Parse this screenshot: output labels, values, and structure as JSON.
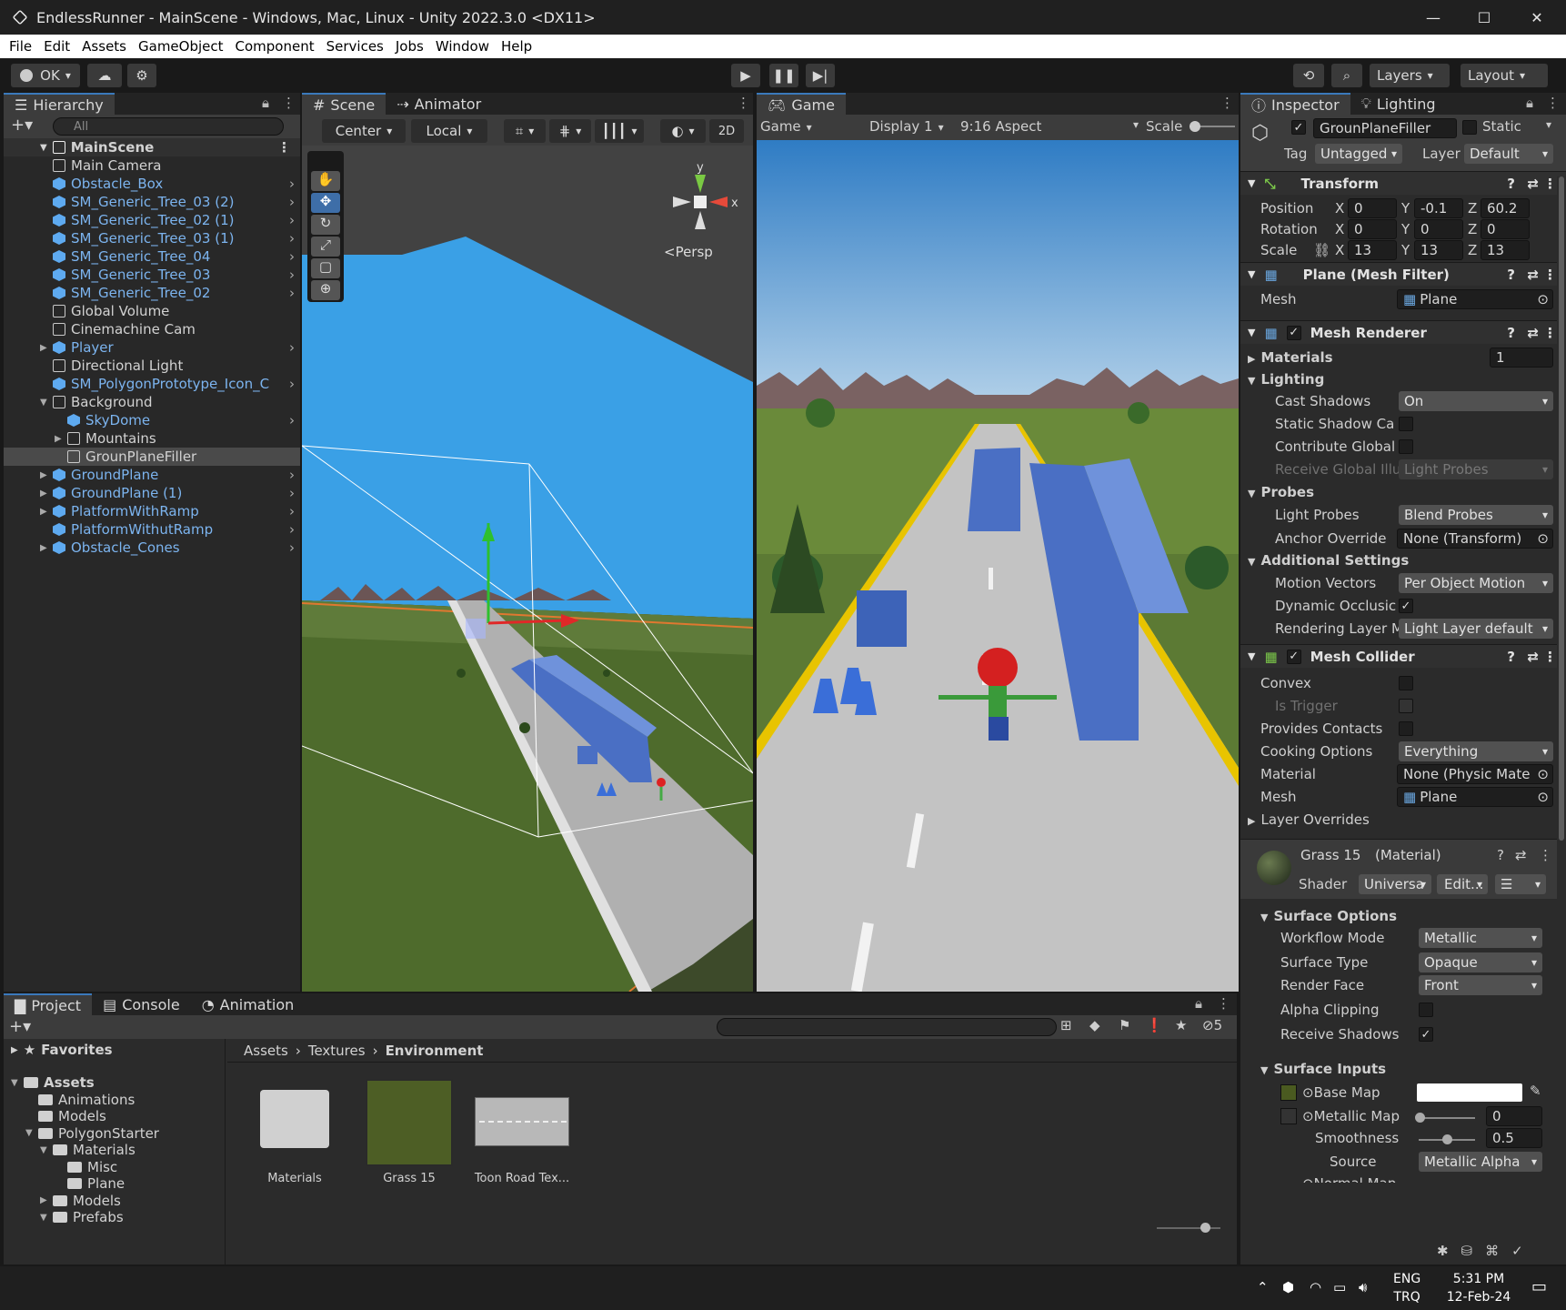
{
  "window": {
    "title": "EndlessRunner - MainScene - Windows, Mac, Linux - Unity 2022.3.0 <DX11>",
    "minimize": "—",
    "maximize": "☐",
    "close": "✕"
  },
  "menu": [
    "File",
    "Edit",
    "Assets",
    "GameObject",
    "Component",
    "Services",
    "Jobs",
    "Window",
    "Help"
  ],
  "toolbar": {
    "account": "OK",
    "layers": "Layers",
    "layout": "Layout"
  },
  "hierarchy": {
    "tab": "Hierarchy",
    "search_placeholder": "All",
    "scene": "MainScene",
    "items": [
      {
        "label": "Main Camera",
        "blue": false
      },
      {
        "label": "Obstacle_Box",
        "blue": true
      },
      {
        "label": "SM_Generic_Tree_03 (2)",
        "blue": true
      },
      {
        "label": "SM_Generic_Tree_02 (1)",
        "blue": true
      },
      {
        "label": "SM_Generic_Tree_03 (1)",
        "blue": true
      },
      {
        "label": "SM_Generic_Tree_04",
        "blue": true
      },
      {
        "label": "SM_Generic_Tree_03",
        "blue": true
      },
      {
        "label": "SM_Generic_Tree_02",
        "blue": true
      },
      {
        "label": "Global Volume",
        "blue": false
      },
      {
        "label": "Cinemachine Cam",
        "blue": false
      },
      {
        "label": "Player",
        "blue": true
      },
      {
        "label": "Directional Light",
        "blue": false
      },
      {
        "label": "SM_PolygonPrototype_Icon_C",
        "blue": true
      },
      {
        "label": "Background",
        "blue": false
      },
      {
        "label": "SkyDome",
        "blue": true
      },
      {
        "label": "Mountains",
        "blue": false
      },
      {
        "label": "GrounPlaneFiller",
        "blue": false
      },
      {
        "label": "GroundPlane",
        "blue": true
      },
      {
        "label": "GroundPlane (1)",
        "blue": true
      },
      {
        "label": "PlatformWithRamp",
        "blue": true
      },
      {
        "label": "PlatformWithutRamp",
        "blue": true
      },
      {
        "label": "Obstacle_Cones",
        "blue": true
      }
    ]
  },
  "scene": {
    "tab": "Scene",
    "tab2": "Animator",
    "pivot": "Center",
    "space": "Local",
    "mode2d": "2D",
    "persp": "<Persp",
    "axis_x": "x",
    "axis_y": "y"
  },
  "game": {
    "tab": "Game",
    "view": "Game",
    "display": "Display 1",
    "aspect": "9:16 Aspect",
    "scale": "Scale"
  },
  "inspector": {
    "tab": "Inspector",
    "tab2": "Lighting",
    "object_name": "GrounPlaneFiller",
    "static": "Static",
    "tag_label": "Tag",
    "tag": "Untagged",
    "layer_label": "Layer",
    "layer": "Default",
    "transform": {
      "title": "Transform",
      "position": {
        "label": "Position",
        "x": "0",
        "y": "-0.1",
        "z": "60.2"
      },
      "rotation": {
        "label": "Rotation",
        "x": "0",
        "y": "0",
        "z": "0"
      },
      "scale": {
        "label": "Scale",
        "x": "13",
        "y": "13",
        "z": "13"
      }
    },
    "mesh_filter": {
      "title": "Plane (Mesh Filter)",
      "mesh_label": "Mesh",
      "mesh": "Plane"
    },
    "mesh_renderer": {
      "title": "Mesh Renderer",
      "materials": "Materials",
      "materials_count": "1",
      "lighting": "Lighting",
      "cast_shadows": "Cast Shadows",
      "cast_shadows_val": "On",
      "static_shadow": "Static Shadow Ca",
      "contribute_gi": "Contribute Global",
      "receive_gi": "Receive Global Illu",
      "receive_gi_val": "Light Probes",
      "probes": "Probes",
      "light_probes": "Light Probes",
      "light_probes_val": "Blend Probes",
      "anchor_override": "Anchor Override",
      "anchor_override_val": "None (Transform)",
      "additional": "Additional Settings",
      "motion_vectors": "Motion Vectors",
      "motion_vectors_val": "Per Object Motion",
      "dynamic_occlusion": "Dynamic Occlusic",
      "rendering_layer": "Rendering Layer M",
      "rendering_layer_val": "Light Layer default"
    },
    "mesh_collider": {
      "title": "Mesh Collider",
      "convex": "Convex",
      "is_trigger": "Is Trigger",
      "provides_contacts": "Provides Contacts",
      "cooking": "Cooking Options",
      "cooking_val": "Everything",
      "material": "Material",
      "material_val": "None (Physic Mate",
      "mesh": "Mesh",
      "mesh_val": "Plane",
      "layer_overrides": "Layer Overrides"
    },
    "material": {
      "name": "Grass 15",
      "type": "(Material)",
      "shader_label": "Shader",
      "shader": "Universa",
      "edit": "Edit...",
      "surface_options": "Surface Options",
      "workflow": "Workflow Mode",
      "workflow_val": "Metallic",
      "surface_type": "Surface Type",
      "surface_type_val": "Opaque",
      "render_face": "Render Face",
      "render_face_val": "Front",
      "alpha_clipping": "Alpha Clipping",
      "receive_shadows": "Receive Shadows",
      "surface_inputs": "Surface Inputs",
      "base_map": "Base Map",
      "metallic_map": "Metallic Map",
      "metallic_val": "0",
      "smoothness": "Smoothness",
      "smoothness_val": "0.5",
      "source": "Source",
      "source_val": "Metallic Alpha",
      "normal_map": "Normal Map"
    }
  },
  "project": {
    "tabs": [
      "Project",
      "Console",
      "Animation"
    ],
    "favorites": "Favorites",
    "tree": [
      {
        "label": "Assets",
        "bold": true
      },
      {
        "label": "Animations"
      },
      {
        "label": "Models"
      },
      {
        "label": "PolygonStarter"
      },
      {
        "label": "Materials"
      },
      {
        "label": "Misc"
      },
      {
        "label": "Plane"
      },
      {
        "label": "Models"
      },
      {
        "label": "Prefabs"
      }
    ],
    "breadcrumb": [
      "Assets",
      "Textures",
      "Environment"
    ],
    "assets": [
      "Materials",
      "Grass 15",
      "Toon Road Tex..."
    ],
    "hidden_count": "5"
  },
  "taskbar": {
    "lang1": "ENG",
    "lang2": "TRQ",
    "time": "5:31 PM",
    "date": "12-Feb-24"
  }
}
